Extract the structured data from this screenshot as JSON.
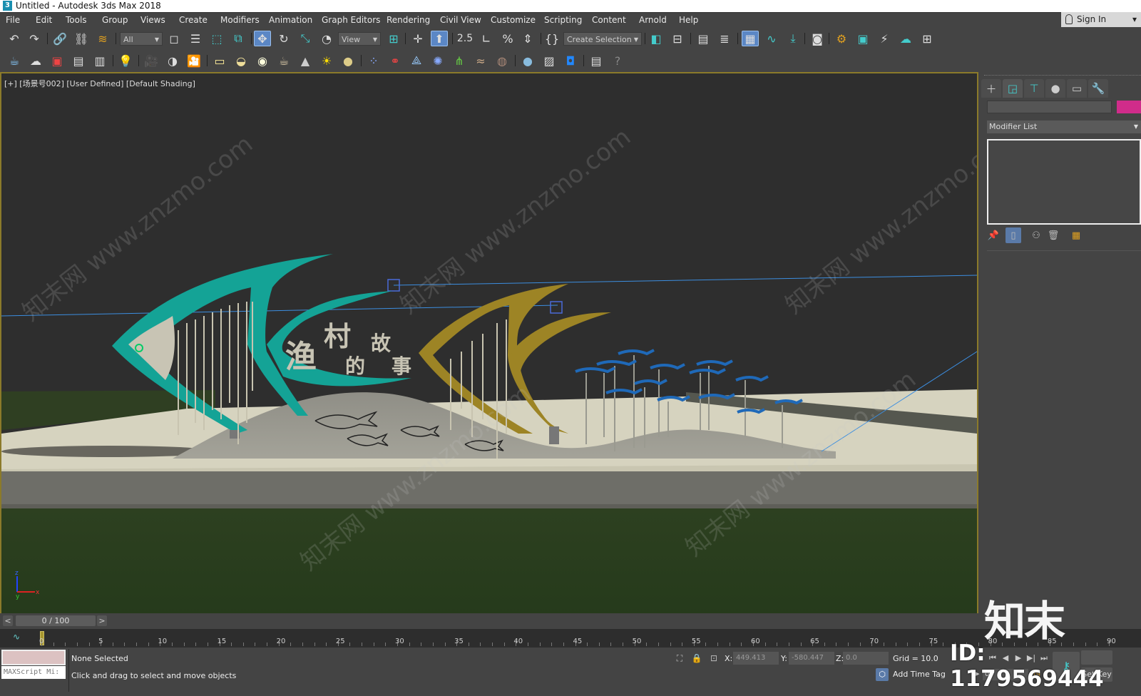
{
  "window": {
    "title": "Untitled - Autodesk 3ds Max 2018",
    "app_icon": "3"
  },
  "menu": [
    "File",
    "Edit",
    "Tools",
    "Group",
    "Views",
    "Create",
    "Modifiers",
    "Animation",
    "Graph Editors",
    "Rendering",
    "Civil View",
    "Customize",
    "Scripting",
    "Content",
    "Arnold",
    "Help"
  ],
  "signin": {
    "label": "Sign In",
    "arrow": "▾"
  },
  "toolbar": {
    "selection_filter": "All",
    "ref_coord": "View",
    "named_selection": "Create Selection Set",
    "snap_label": "2.5",
    "percent": "%"
  },
  "viewport": {
    "label": "[+] [场景号002] [User Defined] [Default Shading]",
    "sign_chars": [
      "渔",
      "村",
      "的",
      "故",
      "事"
    ],
    "axis": {
      "x": "x",
      "y": "y",
      "z": "z"
    },
    "colors": {
      "teal_fish": "#14a396",
      "gold_fish": "#9d8425",
      "blue_fish": "#1f69b8",
      "sky": "#2e2e2e",
      "plaza": "#d6d3bf",
      "grass": "#2f4221"
    }
  },
  "command_panel": {
    "modifier_list": "Modifier List",
    "object_color": "#d02c8a"
  },
  "time_slider": {
    "value": "0 / 100",
    "prev": "<",
    "next": ">",
    "current_frame": 0,
    "total_frames": 100
  },
  "ruler": {
    "labels": [
      "0",
      "5",
      "10",
      "15",
      "20",
      "25",
      "30",
      "35",
      "40",
      "45",
      "50",
      "55",
      "60",
      "65",
      "70",
      "75",
      "80",
      "85",
      "90"
    ]
  },
  "status": {
    "maxscript_placeholder": "MAXScript Mi:",
    "selection": "None Selected",
    "prompt": "Click and drag to select and move objects",
    "x_label": "X:",
    "x_value": "449.413",
    "y_label": "Y:",
    "y_value": "-580.447",
    "z_label": "Z:",
    "z_value": "0.0",
    "grid": "Grid = 10.0",
    "add_time_tag": "Add Time Tag",
    "frame_field": "0",
    "set_key": "Set Key"
  },
  "watermark": {
    "logo": "知末",
    "id": "ID: 1179569444",
    "diag": "知末网 www.znzmo.com"
  }
}
